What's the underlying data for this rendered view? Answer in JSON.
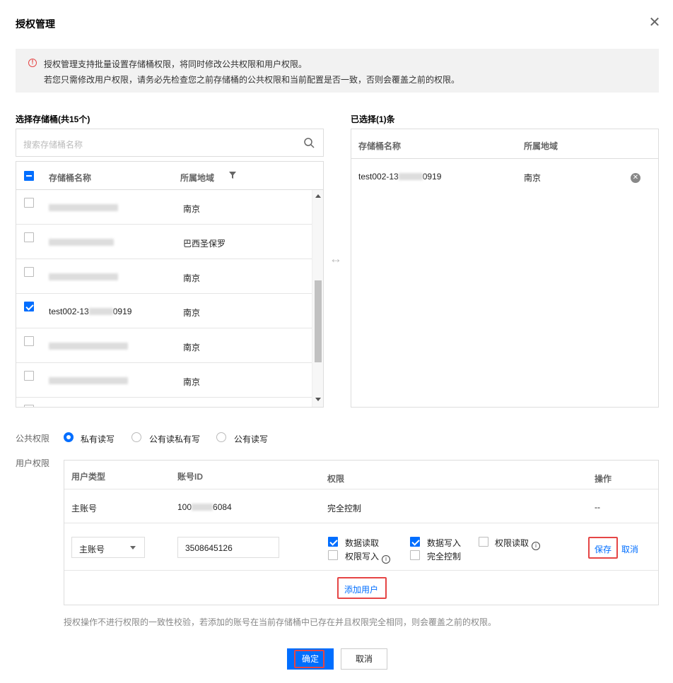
{
  "dialog": {
    "title": "授权管理"
  },
  "notice": {
    "line1": "授权管理支持批量设置存储桶权限，将同时修改公共权限和用户权限。",
    "line2": "若您只需修改用户权限，请务必先检查您之前存储桶的公共权限和当前配置是否一致，否则会覆盖之前的权限。"
  },
  "left": {
    "title": "选择存储桶(共15个)",
    "search_placeholder": "搜索存储桶名称",
    "col_name": "存储桶名称",
    "col_region": "所属地域",
    "rows": [
      {
        "name": "",
        "region": "南京",
        "checked": false
      },
      {
        "name": "",
        "region": "巴西圣保罗",
        "checked": false
      },
      {
        "name": "",
        "region": "南京",
        "checked": false
      },
      {
        "name": "test002-13",
        "name_suffix": "0919",
        "region": "南京",
        "checked": true
      },
      {
        "name": "",
        "region": "南京",
        "checked": false
      },
      {
        "name": "",
        "region": "南京",
        "checked": false
      }
    ]
  },
  "right": {
    "title": "已选择(1)条",
    "col_name": "存储桶名称",
    "col_region": "所属地域",
    "rows": [
      {
        "name": "test002-13",
        "name_suffix": "0919",
        "region": "南京"
      }
    ]
  },
  "public_perm": {
    "label": "公共权限",
    "options": [
      "私有读写",
      "公有读私有写",
      "公有读写"
    ],
    "selected": "私有读写"
  },
  "user_perm": {
    "label": "用户权限",
    "headers": {
      "type": "用户类型",
      "id": "账号ID",
      "perm": "权限",
      "op": "操作"
    },
    "row1": {
      "type": "主账号",
      "id_prefix": "100",
      "id_suffix": "6084",
      "perm": "完全控制",
      "op": "--"
    },
    "row2": {
      "type": "主账号",
      "id": "3508645126",
      "perms": [
        {
          "label": "数据读取",
          "checked": true
        },
        {
          "label": "数据写入",
          "checked": true
        },
        {
          "label": "权限读取",
          "checked": false
        },
        {
          "label": "权限写入",
          "checked": false
        },
        {
          "label": "完全控制",
          "checked": false
        }
      ],
      "save": "保存",
      "cancel": "取消"
    },
    "add_user": "添加用户"
  },
  "hint": "授权操作不进行权限的一致性校验，若添加的账号在当前存储桶中已存在并且权限完全相同，则会覆盖之前的权限。",
  "footer": {
    "ok": "确定",
    "cancel": "取消"
  },
  "colors": {
    "accent": "#006eff",
    "highlight": "#e54545"
  }
}
